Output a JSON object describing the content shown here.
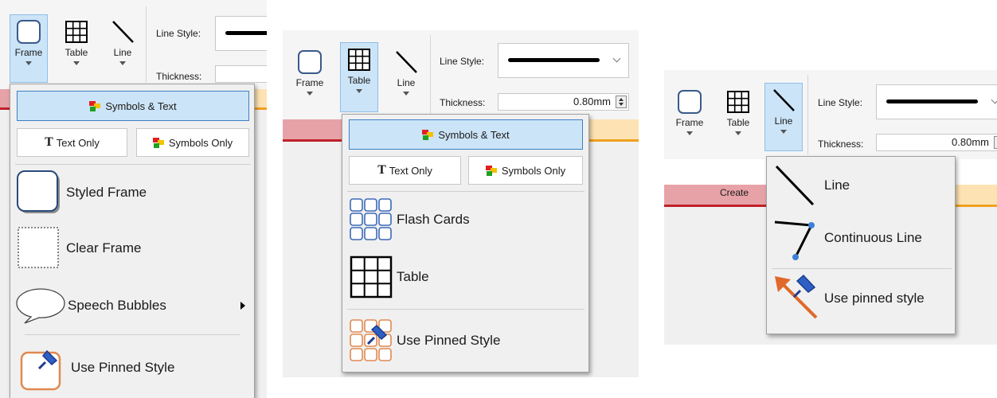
{
  "ribbon": {
    "frame_label": "Frame",
    "table_label": "Table",
    "line_label": "Line",
    "line_style_label": "Line Style:",
    "thickness_label": "Thickness:",
    "thickness_value": "0.80mm"
  },
  "band": {
    "create_label": "Create"
  },
  "menu1": {
    "symbols_text": "Symbols & Text",
    "text_only": "Text Only",
    "symbols_only": "Symbols Only",
    "styled_frame": "Styled Frame",
    "clear_frame": "Clear Frame",
    "speech_bubbles": "Speech Bubbles",
    "use_pinned": "Use Pinned Style"
  },
  "menu2": {
    "symbols_text": "Symbols & Text",
    "text_only": "Text Only",
    "symbols_only": "Symbols Only",
    "flash_cards": "Flash Cards",
    "table": "Table",
    "use_pinned": "Use Pinned Style"
  },
  "menu3": {
    "line": "Line",
    "continuous_line": "Continuous Line",
    "use_pinned": "Use pinned style"
  },
  "colors": {
    "selection": "#cce4f7",
    "accent_red": "#c0202a",
    "accent_orange": "#f0a020",
    "pink": "#e7a2a8"
  }
}
